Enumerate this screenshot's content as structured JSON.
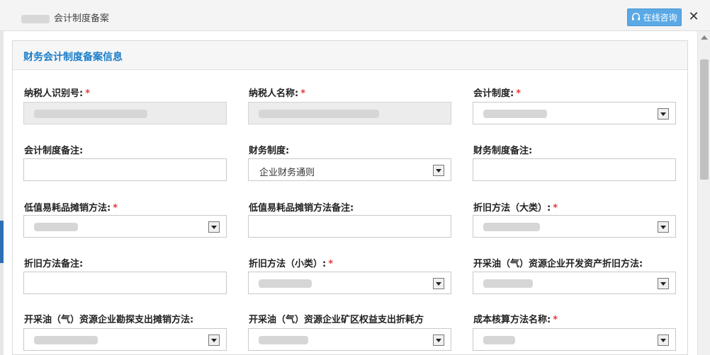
{
  "window": {
    "title": "会计制度备案",
    "consult_label": "在线咨询",
    "close_glyph": "✕"
  },
  "panel": {
    "title": "财务会计制度备案信息"
  },
  "fields": {
    "taxpayer_id": {
      "label": "纳税人识别号:",
      "required": "*"
    },
    "taxpayer_name": {
      "label": "纳税人名称:",
      "required": "*"
    },
    "accounting_system": {
      "label": "会计制度:",
      "required": "*"
    },
    "accounting_note": {
      "label": "会计制度备注:",
      "value": ""
    },
    "finance_system": {
      "label": "财务制度:",
      "value": "企业财务通则"
    },
    "finance_note": {
      "label": "财务制度备注:",
      "value": ""
    },
    "low_value_method": {
      "label": "低值易耗品摊销方法:",
      "required": "*"
    },
    "low_value_note": {
      "label": "低值易耗品摊销方法备注:",
      "value": ""
    },
    "depreciation_major": {
      "label": "折旧方法（大类）:",
      "required": "*"
    },
    "depreciation_note": {
      "label": "折旧方法备注:",
      "value": ""
    },
    "depreciation_minor": {
      "label": "折旧方法（小类）:",
      "required": "*"
    },
    "oil_dev_depreciation": {
      "label": "开采油（气）资源企业开发资产折旧方法:"
    },
    "oil_exploration_amort": {
      "label": "开采油（气）资源企业勘探支出摊销方法:"
    },
    "oil_mining_rights": {
      "label": "开采油（气）资源企业矿区权益支出折耗方"
    },
    "cost_method_name": {
      "label": "成本核算方法名称:",
      "required": "*"
    }
  },
  "colors": {
    "accent": "#1a7ec9",
    "button": "#5aa9e6",
    "required": "#e4393c"
  },
  "icons": [
    "headset-icon",
    "close-icon",
    "dropdown-arrow-icon"
  ]
}
